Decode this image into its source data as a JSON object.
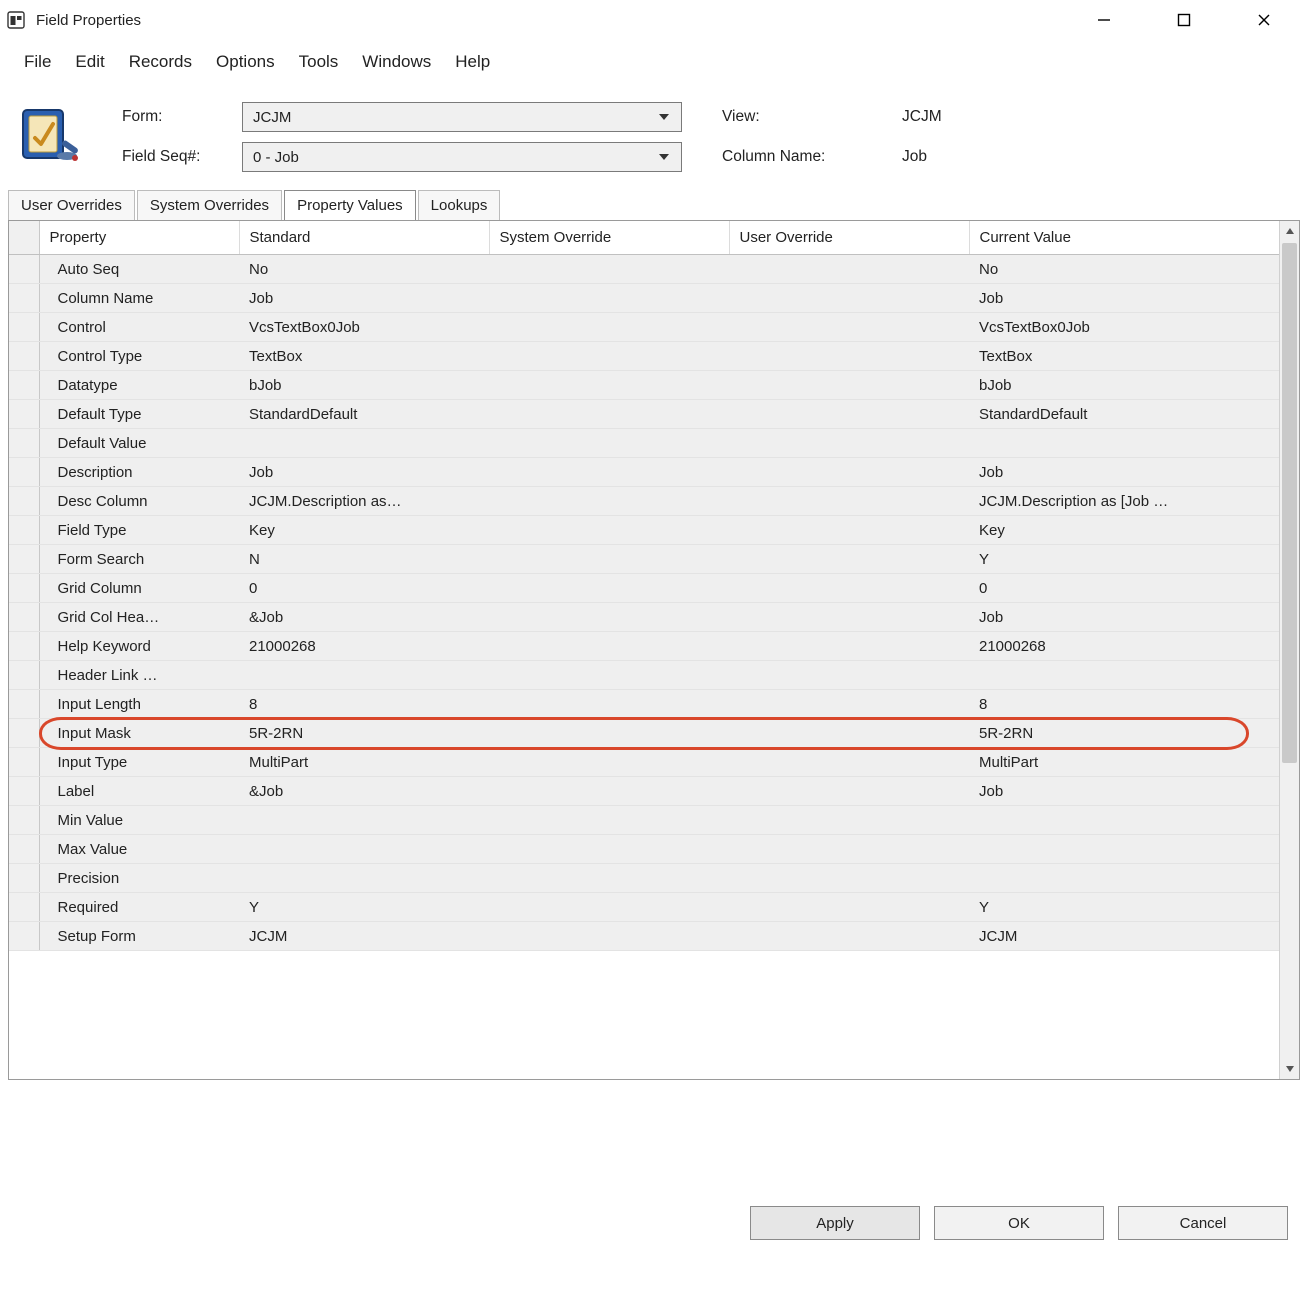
{
  "window": {
    "title": "Field Properties"
  },
  "menubar": [
    "File",
    "Edit",
    "Records",
    "Options",
    "Tools",
    "Windows",
    "Help"
  ],
  "top_form": {
    "form_label": "Form:",
    "form_value": "JCJM",
    "fieldseq_label": "Field Seq#:",
    "fieldseq_value": "0 - Job",
    "view_label": "View:",
    "view_value": "JCJM",
    "colname_label": "Column Name:",
    "colname_value": "Job"
  },
  "tabs": [
    {
      "label": "User Overrides",
      "active": false
    },
    {
      "label": "System Overrides",
      "active": false
    },
    {
      "label": "Property Values",
      "active": true
    },
    {
      "label": "Lookups",
      "active": false
    }
  ],
  "grid": {
    "headers": [
      "Property",
      "Standard",
      "System Override",
      "User Override",
      "Current Value"
    ],
    "rows": [
      {
        "property": "Auto Seq",
        "standard": "No",
        "system": "",
        "user": "",
        "current": "No"
      },
      {
        "property": "Column Name",
        "standard": "Job",
        "system": "",
        "user": "",
        "current": "Job"
      },
      {
        "property": "Control",
        "standard": "VcsTextBox0Job",
        "system": "",
        "user": "",
        "current": "VcsTextBox0Job"
      },
      {
        "property": "Control Type",
        "standard": "TextBox",
        "system": "",
        "user": "",
        "current": "TextBox"
      },
      {
        "property": "Datatype",
        "standard": "bJob",
        "system": "",
        "user": "",
        "current": "bJob"
      },
      {
        "property": "Default Type",
        "standard": "StandardDefault",
        "system": "",
        "user": "",
        "current": "StandardDefault"
      },
      {
        "property": "Default Value",
        "standard": "",
        "system": "",
        "user": "",
        "current": ""
      },
      {
        "property": "Description",
        "standard": "Job",
        "system": "",
        "user": "",
        "current": "Job"
      },
      {
        "property": "Desc Column",
        "standard": "JCJM.Description as…",
        "system": "",
        "user": "",
        "current": "JCJM.Description as [Job …"
      },
      {
        "property": "Field Type",
        "standard": "Key",
        "system": "",
        "user": "",
        "current": "Key"
      },
      {
        "property": "Form Search",
        "standard": "N",
        "system": "",
        "user": "",
        "current": "Y"
      },
      {
        "property": "Grid Column",
        "standard": "0",
        "system": "",
        "user": "",
        "current": "0"
      },
      {
        "property": "Grid Col Hea…",
        "standard": "&Job",
        "system": "",
        "user": "",
        "current": "Job"
      },
      {
        "property": "Help Keyword",
        "standard": "21000268",
        "system": "",
        "user": "",
        "current": "21000268"
      },
      {
        "property": "Header Link …",
        "standard": "",
        "system": "",
        "user": "",
        "current": ""
      },
      {
        "property": "Input Length",
        "standard": "8",
        "system": "",
        "user": "",
        "current": "8"
      },
      {
        "property": "Input Mask",
        "standard": "5R-2RN",
        "system": "",
        "user": "",
        "current": "5R-2RN",
        "highlight": true
      },
      {
        "property": "Input Type",
        "standard": "MultiPart",
        "system": "",
        "user": "",
        "current": "MultiPart"
      },
      {
        "property": "Label",
        "standard": "&Job",
        "system": "",
        "user": "",
        "current": "Job"
      },
      {
        "property": "Min Value",
        "standard": "",
        "system": "",
        "user": "",
        "current": ""
      },
      {
        "property": "Max Value",
        "standard": "",
        "system": "",
        "user": "",
        "current": ""
      },
      {
        "property": "Precision",
        "standard": "",
        "system": "",
        "user": "",
        "current": ""
      },
      {
        "property": "Required",
        "standard": "Y",
        "system": "",
        "user": "",
        "current": "Y"
      },
      {
        "property": "Setup Form",
        "standard": "JCJM",
        "system": "",
        "user": "",
        "current": "JCJM"
      }
    ]
  },
  "footer": {
    "apply": "Apply",
    "ok": "OK",
    "cancel": "Cancel"
  }
}
